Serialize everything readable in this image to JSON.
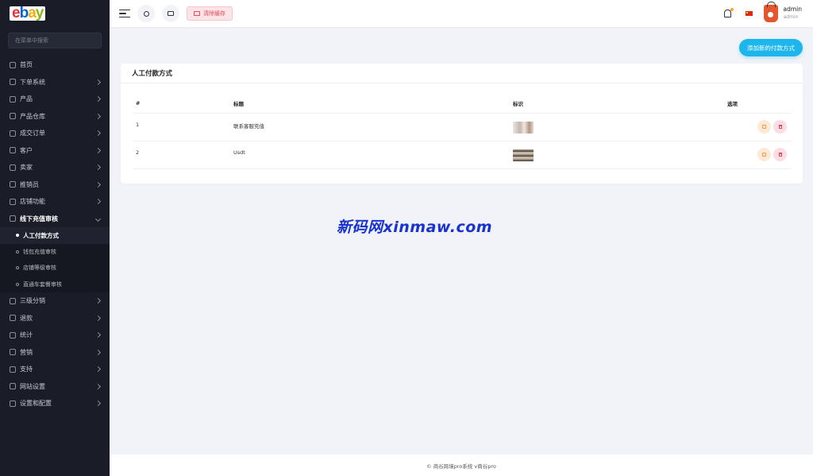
{
  "brand": {
    "logo_letters": [
      "e",
      "b",
      "a",
      "y"
    ]
  },
  "sidebar": {
    "search_placeholder": "在菜单中搜索",
    "items": [
      {
        "label": "首页",
        "icon": "home-icon",
        "has_children": false
      },
      {
        "label": "下单系统",
        "icon": "tag-icon",
        "has_children": true
      },
      {
        "label": "产品",
        "icon": "cart-icon",
        "has_children": true
      },
      {
        "label": "产品仓库",
        "icon": "warehouse-icon",
        "has_children": true
      },
      {
        "label": "成交订单",
        "icon": "order-icon",
        "has_children": true
      },
      {
        "label": "客户",
        "icon": "customers-icon",
        "has_children": true
      },
      {
        "label": "卖家",
        "icon": "seller-icon",
        "has_children": true
      },
      {
        "label": "推销员",
        "icon": "salesman-icon",
        "has_children": true
      },
      {
        "label": "店铺功能",
        "icon": "store-icon",
        "has_children": true
      }
    ],
    "open_item": {
      "label": "线下充值审核",
      "icon": "card-icon"
    },
    "sub_items": [
      {
        "label": "人工付款方式",
        "active": true
      },
      {
        "label": "钱包充值审核",
        "active": false
      },
      {
        "label": "店铺等级审核",
        "active": false
      },
      {
        "label": "直通车套餐审核",
        "active": false
      }
    ],
    "items_after": [
      {
        "label": "三级分销",
        "icon": "link-icon"
      },
      {
        "label": "退款",
        "icon": "refund-icon"
      },
      {
        "label": "统计",
        "icon": "chart-icon"
      },
      {
        "label": "营销",
        "icon": "megaphone-icon"
      },
      {
        "label": "支持",
        "icon": "support-icon"
      },
      {
        "label": "网站设置",
        "icon": "monitor-icon"
      },
      {
        "label": "设置和配置",
        "icon": "gear-icon"
      }
    ]
  },
  "header": {
    "clear_cache_label": "清除缓存",
    "user": {
      "name": "admin",
      "role": "admin"
    }
  },
  "main": {
    "add_button_label": "添加新的付款方式",
    "card_title": "人工付款方式",
    "table": {
      "columns": [
        "#",
        "标题",
        "标识",
        "选项"
      ],
      "rows": [
        {
          "index": "1",
          "title": "联系客服充值"
        },
        {
          "index": "2",
          "title": "Usdt"
        }
      ]
    }
  },
  "watermark": "新码网xinmaw.com",
  "footer": {
    "text": "© 商谷跨境pro系统 v商谷pro"
  },
  "colors": {
    "sidebar_bg": "#1a1c28",
    "accent": "#1cb6ec",
    "danger": "#e0475a",
    "warning": "#f2994a"
  }
}
